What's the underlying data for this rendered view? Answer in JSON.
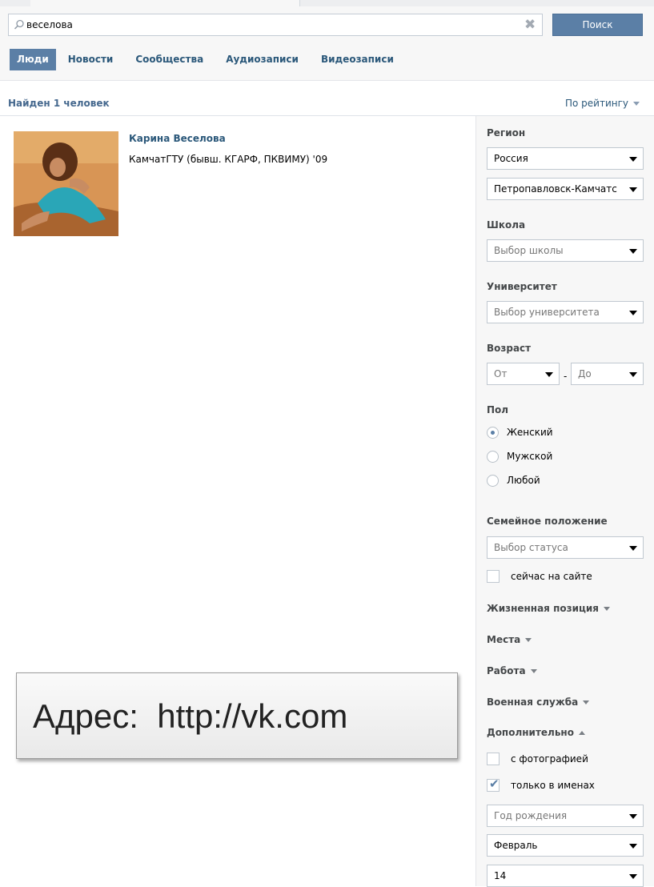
{
  "search": {
    "query": "веселова",
    "button_label": "Поиск"
  },
  "tabs": [
    {
      "label": "Люди",
      "active": true
    },
    {
      "label": "Новости"
    },
    {
      "label": "Сообщества"
    },
    {
      "label": "Аудиозаписи"
    },
    {
      "label": "Видеозаписи"
    }
  ],
  "results": {
    "count_text": "Найден 1 человек",
    "sort_label": "По рейтингу",
    "people": [
      {
        "name": "Карина Веселова",
        "education": "КамчатГТУ (бывш. КГАРФ, ПКВИМУ) '09"
      }
    ]
  },
  "filters": {
    "region": {
      "title": "Регион",
      "country": "Россия",
      "city": "Петропавловск-Камчатс"
    },
    "school": {
      "title": "Школа",
      "placeholder": "Выбор школы"
    },
    "university": {
      "title": "Университет",
      "placeholder": "Выбор университета"
    },
    "age": {
      "title": "Возраст",
      "from_placeholder": "От",
      "dash": "-",
      "to_placeholder": "До"
    },
    "gender": {
      "title": "Пол",
      "options": [
        "Женский",
        "Мужской",
        "Любой"
      ],
      "selected": "Женский"
    },
    "marital": {
      "title": "Семейное положение",
      "placeholder": "Выбор статуса"
    },
    "online_label": "сейчас на сайте",
    "collapsed_sections": [
      "Жизненная позиция",
      "Места",
      "Работа",
      "Военная служба"
    ],
    "additional": {
      "title": "Дополнительно",
      "with_photo_label": "с фотографией",
      "names_only_label": "только в именах",
      "birth_year_placeholder": "Год рождения",
      "birth_month": "Февраль",
      "birth_day": "14"
    }
  },
  "overlay_text": "Адрес:  http://vk.com",
  "colors": {
    "accent": "#5b7fa6",
    "link": "#2b587a",
    "sidebar_bg": "#f7f7f7"
  }
}
